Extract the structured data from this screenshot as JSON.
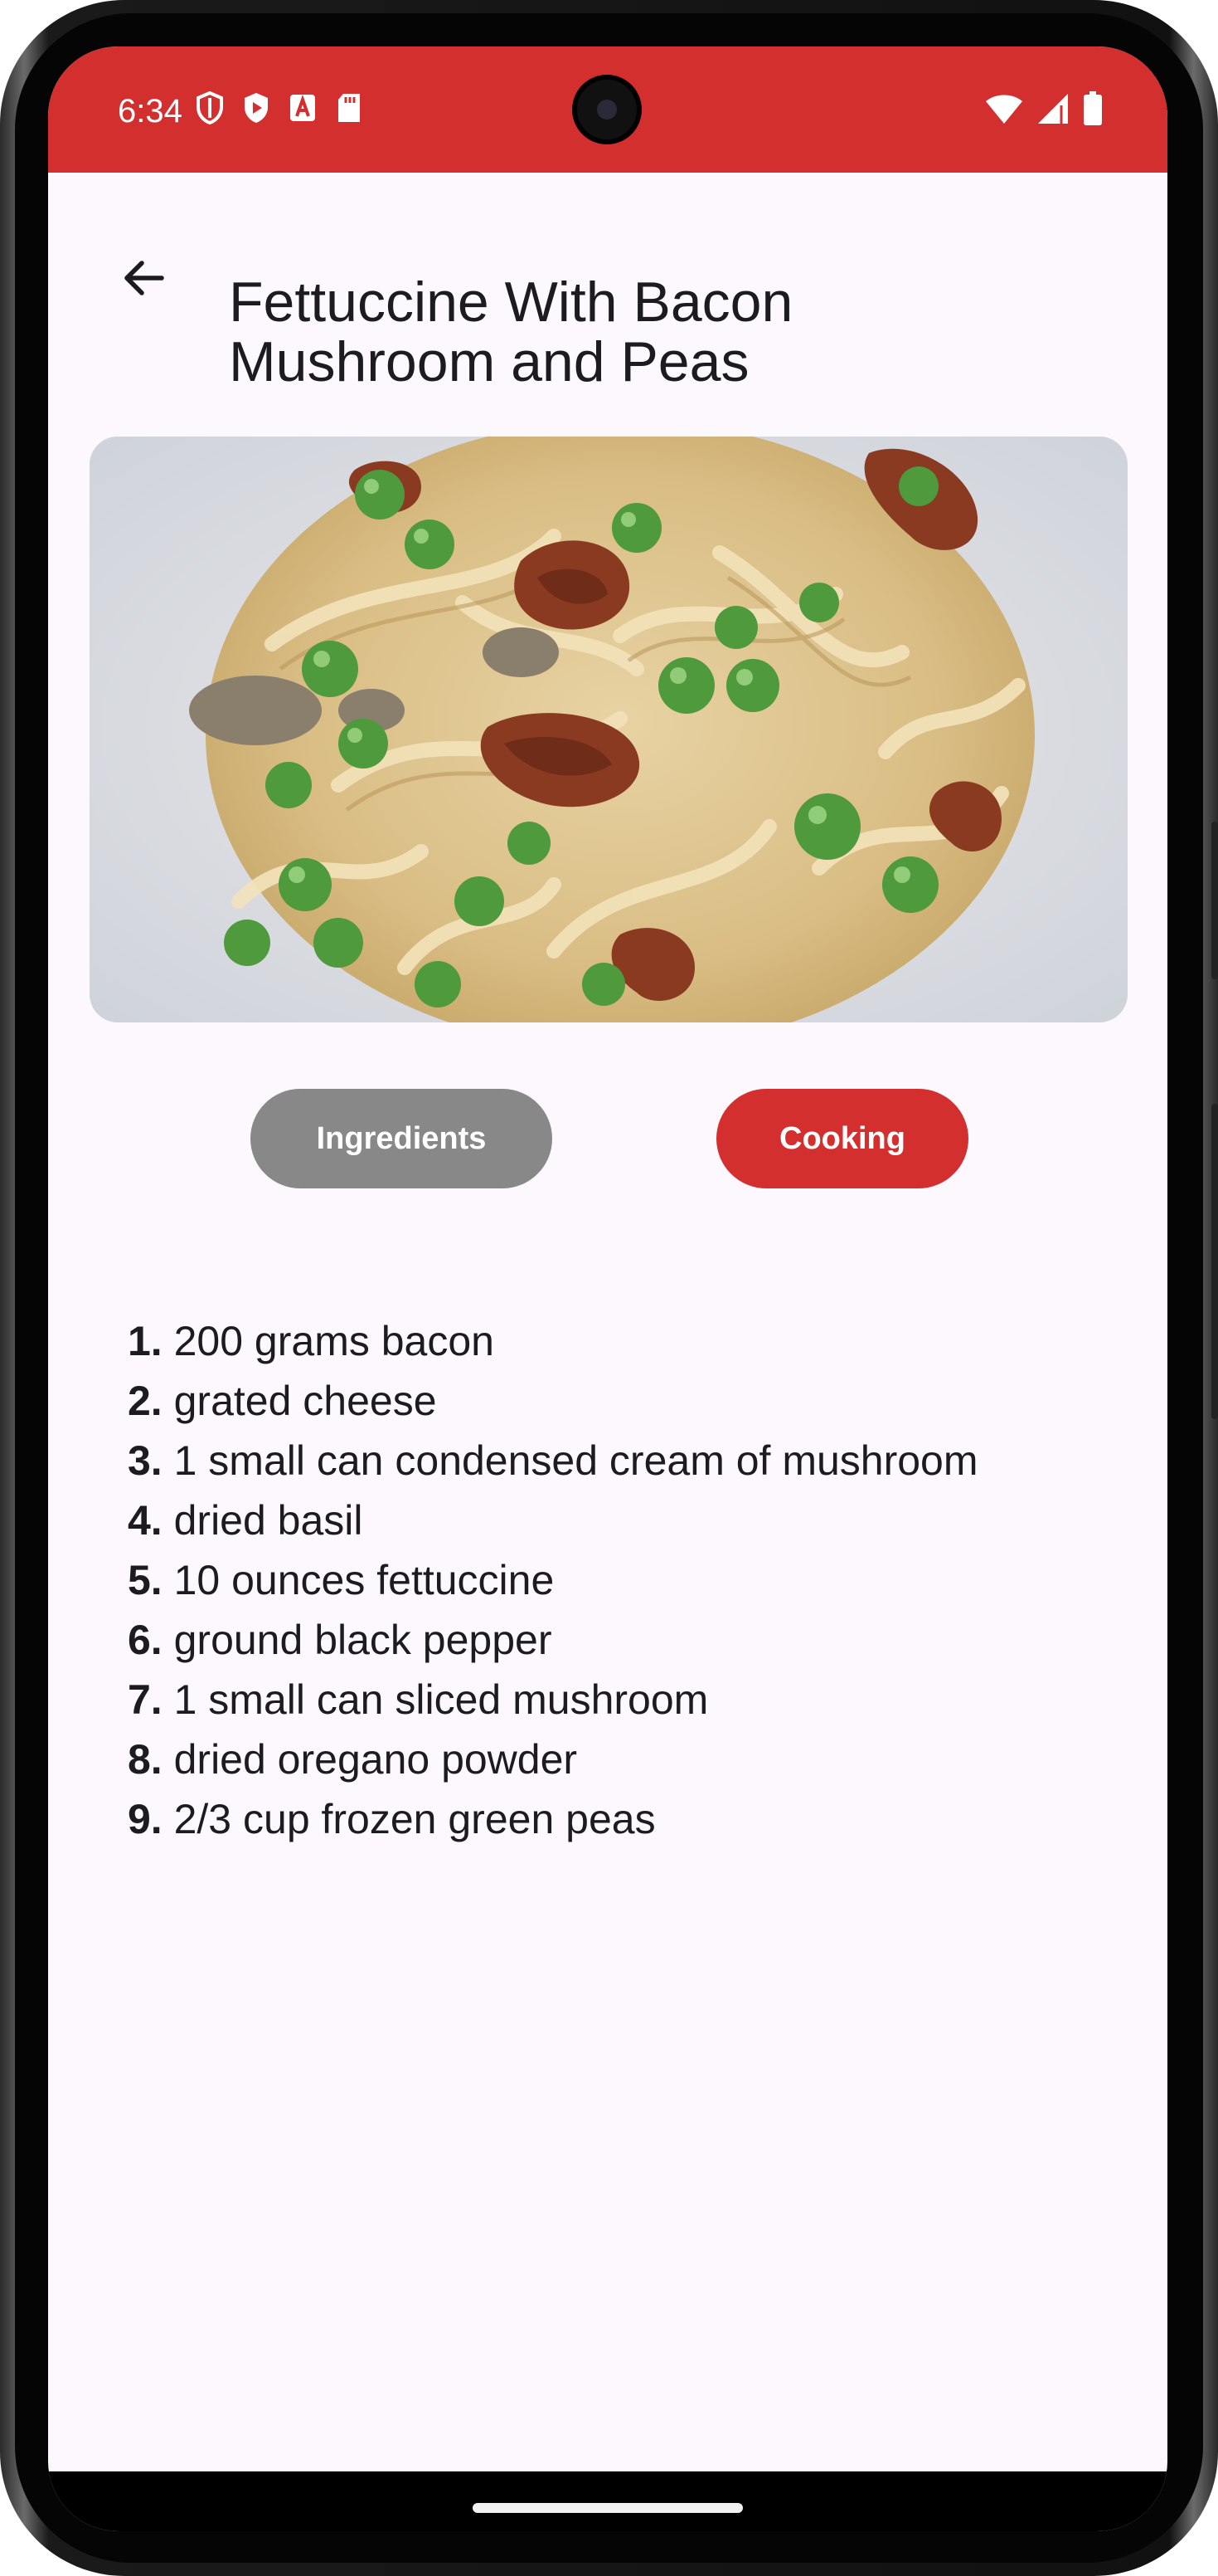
{
  "status_bar": {
    "time": "6:34",
    "left_icons": [
      "shield-outline-icon",
      "play-shield-icon",
      "translate-a-icon",
      "sd-card-icon"
    ],
    "right_icons": [
      "wifi-icon",
      "cellular-signal-icon",
      "battery-icon"
    ],
    "color": "#d32f2f"
  },
  "app_bar": {
    "back_icon": "arrow-left-icon",
    "title": "Fettuccine With Bacon Mushroom and Peas"
  },
  "hero_image": {
    "description_icon": "pasta-photo"
  },
  "tabs": {
    "ingredients_label": "Ingredients",
    "cooking_label": "Cooking",
    "active": "Cooking",
    "active_color": "#d32f2f",
    "inactive_color": "#888888"
  },
  "ingredients": [
    {
      "num": "1.",
      "text": "200 grams bacon"
    },
    {
      "num": "2.",
      "text": "grated cheese"
    },
    {
      "num": "3.",
      "text": "1 small can condensed cream of mushroom"
    },
    {
      "num": "4.",
      "text": "dried basil"
    },
    {
      "num": "5.",
      "text": "10 ounces fettuccine"
    },
    {
      "num": "6.",
      "text": "ground black pepper"
    },
    {
      "num": "7.",
      "text": "1 small can sliced mushroom"
    },
    {
      "num": "8.",
      "text": "dried oregano powder"
    },
    {
      "num": "9.",
      "text": "2/3 cup frozen green peas"
    }
  ]
}
